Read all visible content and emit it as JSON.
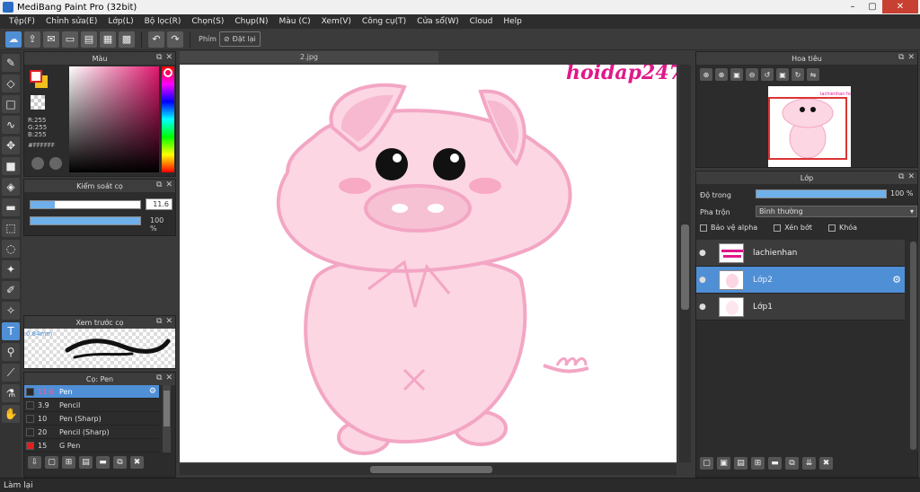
{
  "window": {
    "title": "MediBang Paint Pro (32bit)",
    "controls": [
      "–",
      "▢",
      "✕"
    ]
  },
  "menu": [
    "Tệp(F)",
    "Chỉnh sửa(E)",
    "Lớp(L)",
    "Bộ lọc(R)",
    "Chọn(S)",
    "Chụp(N)",
    "Màu (C)",
    "Xem(V)",
    "Công cụ(T)",
    "Cửa sổ(W)",
    "Cloud",
    "Help"
  ],
  "toolbar": {
    "shortcut_label": "Phím",
    "reset_label": "Đặt lại"
  },
  "color_panel": {
    "title": "Màu",
    "r": "R:255",
    "g": "G:255",
    "b": "B:255",
    "hex": "#FFFFFF",
    "fg_color": "#ffffff",
    "bg_color": "#f0c020"
  },
  "brush_control": {
    "title": "Kiểm soát cọ",
    "size_value": "11.6",
    "size_fraction": 0.22,
    "opacity_value": "100 %",
    "opacity_fraction": 1.0
  },
  "brush_preview": {
    "title": "Xem trước cọ",
    "size_label": "0.84mm"
  },
  "brush_panel": {
    "title": "Cọ: Pen",
    "brushes": [
      {
        "size": "11.6",
        "name": "Pen",
        "selected": true,
        "color": "#2a2a2a"
      },
      {
        "size": "3.9",
        "name": "Pencil",
        "selected": false,
        "color": "#2a2a2a"
      },
      {
        "size": "10",
        "name": "Pen (Sharp)",
        "selected": false,
        "color": "#2a2a2a"
      },
      {
        "size": "20",
        "name": "Pencil (Sharp)",
        "selected": false,
        "color": "#2a2a2a"
      },
      {
        "size": "15",
        "name": "G Pen",
        "selected": false,
        "color": "#e02020"
      }
    ]
  },
  "canvas": {
    "doc_tab": "2.jpg",
    "watermark": "hoidap247",
    "pig_color": "#fcd6e3",
    "outline_color": "#f3a6c4"
  },
  "navigator": {
    "title": "Hoa tiêu",
    "watermark": "lachienhan hoidap247"
  },
  "layer_panel": {
    "title": "Lớp",
    "opacity_label": "Độ trong",
    "opacity_value": "100 %",
    "blend_label": "Pha trộn",
    "blend_value": "Bình thường",
    "protect_alpha": "Bảo vệ alpha",
    "clipping": "Xén bớt",
    "lock": "Khóa",
    "layers": [
      {
        "name": "lachienhan",
        "selected": false
      },
      {
        "name": "Lớp2",
        "selected": true
      },
      {
        "name": "Lớp1",
        "selected": false
      }
    ]
  },
  "status": {
    "text": "Làm lại"
  }
}
